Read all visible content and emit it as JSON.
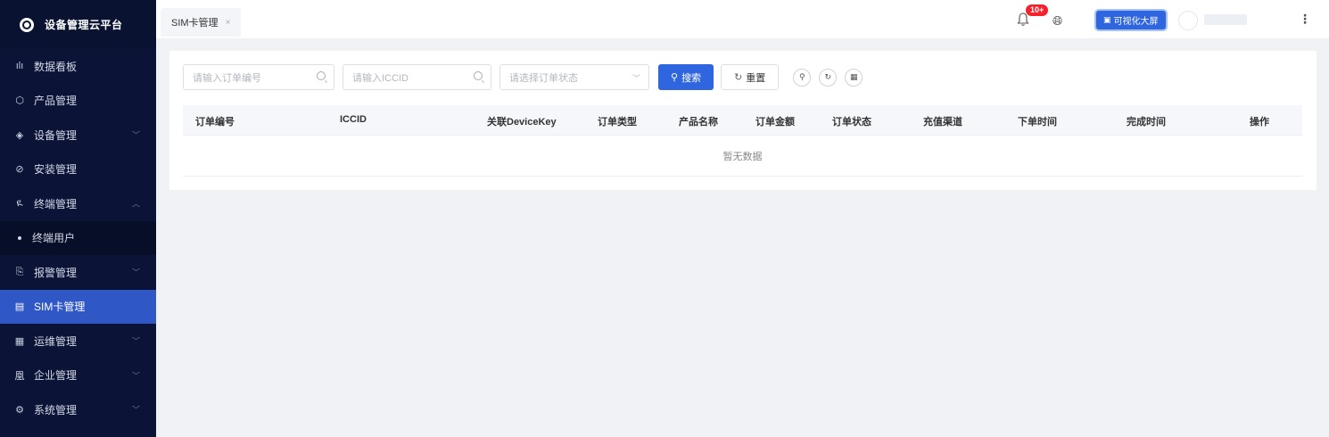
{
  "app": {
    "title": "设备管理云平台"
  },
  "sidebar": {
    "items": [
      {
        "label": "数据看板",
        "icon": "chart-bar-icon",
        "glyph": "ılı",
        "chevron": ""
      },
      {
        "label": "产品管理",
        "icon": "cube-icon",
        "glyph": "⬡",
        "chevron": ""
      },
      {
        "label": "设备管理",
        "icon": "layers-icon",
        "glyph": "◈",
        "chevron": "﹀"
      },
      {
        "label": "安装管理",
        "icon": "settings-circle-icon",
        "glyph": "⊘",
        "chevron": ""
      },
      {
        "label": "终端管理",
        "icon": "user-icon",
        "glyph": "ዪ",
        "chevron": "︿"
      },
      {
        "label": "终端用户",
        "icon": "dot",
        "glyph": "",
        "chevron": "",
        "sub": true
      },
      {
        "label": "报警管理",
        "icon": "alarm-icon",
        "glyph": "⎘",
        "chevron": "﹀"
      },
      {
        "label": "SIM卡管理",
        "icon": "sim-card-icon",
        "glyph": "▤",
        "chevron": "",
        "active": true
      },
      {
        "label": "运维管理",
        "icon": "tool-icon",
        "glyph": "▦",
        "chevron": "﹀"
      },
      {
        "label": "企业管理",
        "icon": "building-icon",
        "glyph": "凰",
        "chevron": "﹀"
      },
      {
        "label": "系统管理",
        "icon": "gear-icon",
        "glyph": "⚙",
        "chevron": "﹀"
      }
    ]
  },
  "topbar": {
    "tab_label": "SIM卡管理",
    "tab_close": "×",
    "notification_badge": "10+",
    "viz_button": "可视化大屏",
    "more": "⋮"
  },
  "search": {
    "order_no_placeholder": "请输入订单编号",
    "iccid_placeholder": "请输入ICCID",
    "status_placeholder": "请选择订单状态",
    "search_button": "搜索",
    "reset_button": "重置"
  },
  "table": {
    "columns": [
      "订单编号",
      "ICCID",
      "关联DeviceKey",
      "订单类型",
      "产品名称",
      "订单金额",
      "订单状态",
      "充值渠道",
      "下单时间",
      "完成时间",
      "操作"
    ],
    "empty_text": "暂无数据"
  },
  "colors": {
    "sidebar_bg": "#0b1437",
    "primary": "#2f66e0",
    "active_menu": "#2f57c6",
    "badge": "#f5222d"
  }
}
